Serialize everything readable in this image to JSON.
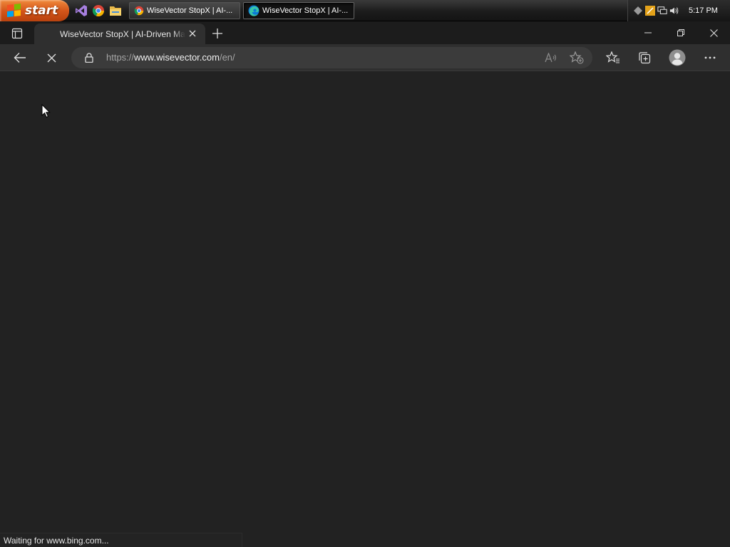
{
  "taskbar": {
    "start_label": "start",
    "quick_launch": [
      "visual-studio-icon",
      "chrome-icon",
      "file-explorer-icon"
    ],
    "tasks": [
      {
        "label": "WiseVector StopX | AI-...",
        "icon": "chrome-icon",
        "active": false
      },
      {
        "label": "WiseVector StopX | AI-...",
        "icon": "edge-icon",
        "active": true
      }
    ],
    "tray_icons": [
      "diamond-icon",
      "sticky-note-icon",
      "network-icon",
      "volume-icon"
    ],
    "clock": "5:17 PM"
  },
  "browser": {
    "tab": {
      "title": "WiseVector StopX | AI-Driven Malware Protection",
      "loading": true
    },
    "address": {
      "scheme": "https://",
      "host": "www.wisevector.com",
      "path": "/en/"
    },
    "status_text": "Waiting for www.bing.com..."
  },
  "colors": {
    "page_bg": "#222222",
    "tab_active_bg": "#2f2f2f",
    "address_bg": "#3b3b3b",
    "start_orange": "#d4561a"
  }
}
